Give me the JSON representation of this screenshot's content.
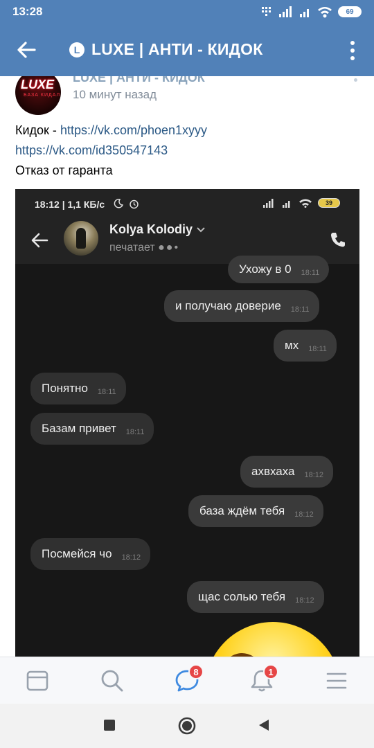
{
  "status_bar": {
    "time": "13:28",
    "battery": "69"
  },
  "app_bar": {
    "title": "LUXE | АНТИ - КИДОК",
    "title_letter": "L"
  },
  "post": {
    "author": "LUXE | АНТИ - КИДОК",
    "avatar_logo": "LUXE",
    "avatar_sub": "БАЗА КИДАЛ",
    "time": "10 минут назад",
    "line1_prefix": "Кидок - ",
    "line1_link": "https://vk.com/phoen1xyyy",
    "line2_link": "https://vk.com/id350547143",
    "line3": "Отказ от гаранта"
  },
  "screenshot": {
    "status_time": "18:12 | 1,1 КБ/с",
    "battery": "39",
    "contact_name": "Kolya Kolodiy",
    "typing": "печатает",
    "messages": [
      {
        "text": "Ухожу в 0",
        "time": "18:11",
        "dir": "out"
      },
      {
        "text": "и получаю доверие",
        "time": "18:11",
        "dir": "out"
      },
      {
        "text": "мх",
        "time": "18:11",
        "dir": "out"
      },
      {
        "text": "Понятно",
        "time": "18:11",
        "dir": "in"
      },
      {
        "text": "Базам привет",
        "time": "18:11",
        "dir": "in"
      },
      {
        "text": "ахвхаха",
        "time": "18:12",
        "dir": "out"
      },
      {
        "text": "база ждём тебя",
        "time": "18:12",
        "dir": "out"
      },
      {
        "text": "Посмейся чо",
        "time": "18:12",
        "dir": "in"
      },
      {
        "text": "щас солью тебя",
        "time": "18:12",
        "dir": "out"
      }
    ]
  },
  "bottom_nav": {
    "messages_badge": "8",
    "notifications_badge": "1",
    "items": [
      "news-icon",
      "search-icon",
      "messages-icon",
      "notifications-icon",
      "menu-icon"
    ]
  },
  "colors": {
    "header": "#5181b8",
    "link": "#2a5885",
    "badge": "#e64646"
  }
}
